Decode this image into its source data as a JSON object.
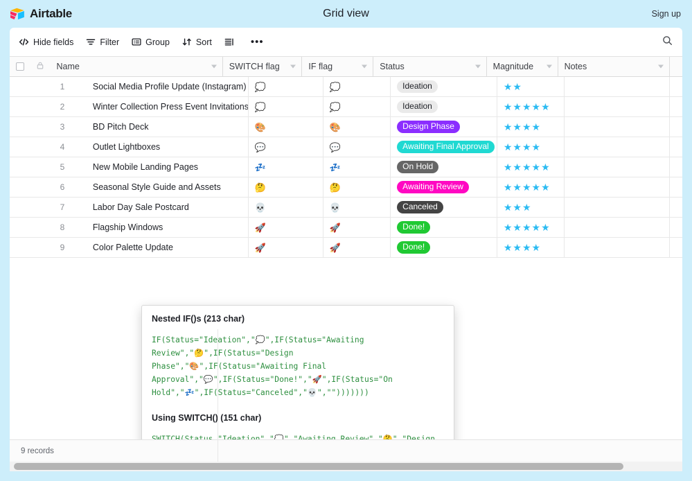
{
  "app": {
    "brand_name": "Airtable",
    "view_title": "Grid view",
    "signup_label": "Sign up",
    "accent_blue": "#cdeefb",
    "star_color": "#2bbbf2"
  },
  "toolbar": {
    "buttons": [
      {
        "label": "Hide fields",
        "icon": "code-brackets-icon"
      },
      {
        "label": "Filter",
        "icon": "filter-icon"
      },
      {
        "label": "Group",
        "icon": "group-icon"
      },
      {
        "label": "Sort",
        "icon": "sort-icon"
      },
      {
        "label": "",
        "icon": "row-height-icon"
      },
      {
        "label": "",
        "icon": "more-options-icon"
      }
    ],
    "search_icon": "search-icon"
  },
  "table": {
    "columns": [
      {
        "key": "name",
        "label": "Name"
      },
      {
        "key": "switch_flag",
        "label": "SWITCH flag"
      },
      {
        "key": "if_flag",
        "label": "IF flag"
      },
      {
        "key": "status",
        "label": "Status"
      },
      {
        "key": "magnitude",
        "label": "Magnitude"
      },
      {
        "key": "notes",
        "label": "Notes"
      }
    ],
    "rows": [
      {
        "num": "1",
        "name": "Social Media Profile Update (Instagram)",
        "switch_flag": "💭",
        "if_flag": "💭",
        "status": "Ideation",
        "status_bg": "#eaeaea",
        "status_fg": "#1d1f25",
        "magnitude": 2,
        "notes": ""
      },
      {
        "num": "2",
        "name": "Winter Collection Press Event Invitations",
        "switch_flag": "💭",
        "if_flag": "💭",
        "status": "Ideation",
        "status_bg": "#eaeaea",
        "status_fg": "#1d1f25",
        "magnitude": 5,
        "notes": ""
      },
      {
        "num": "3",
        "name": "BD Pitch Deck",
        "switch_flag": "🎨",
        "if_flag": "🎨",
        "status": "Design Phase",
        "status_bg": "#8b2eff",
        "status_fg": "#ffffff",
        "magnitude": 4,
        "notes": ""
      },
      {
        "num": "4",
        "name": "Outlet Lightboxes",
        "switch_flag": "💬",
        "if_flag": "💬",
        "status": "Awaiting Final Approval",
        "status_bg": "#20d9d2",
        "status_fg": "#ffffff",
        "magnitude": 4,
        "notes": ""
      },
      {
        "num": "5",
        "name": "New Mobile Landing Pages",
        "switch_flag": "💤",
        "if_flag": "💤",
        "status": "On Hold",
        "status_bg": "#666666",
        "status_fg": "#ffffff",
        "magnitude": 5,
        "notes": ""
      },
      {
        "num": "6",
        "name": "Seasonal Style Guide and Assets",
        "switch_flag": "🤔",
        "if_flag": "🤔",
        "status": "Awaiting Review",
        "status_bg": "#ff08c2",
        "status_fg": "#ffffff",
        "magnitude": 5,
        "notes": ""
      },
      {
        "num": "7",
        "name": "Labor Day Sale Postcard",
        "switch_flag": "💀",
        "if_flag": "💀",
        "status": "Canceled",
        "status_bg": "#444444",
        "status_fg": "#ffffff",
        "magnitude": 3,
        "notes": ""
      },
      {
        "num": "8",
        "name": "Flagship Windows",
        "switch_flag": "🚀",
        "if_flag": "🚀",
        "status": "Done!",
        "status_bg": "#20c933",
        "status_fg": "#ffffff",
        "magnitude": 5,
        "notes": ""
      },
      {
        "num": "9",
        "name": "Color Palette Update",
        "switch_flag": "🚀",
        "if_flag": "🚀",
        "status": "Done!",
        "status_bg": "#20c933",
        "status_fg": "#ffffff",
        "magnitude": 4,
        "notes": ""
      }
    ]
  },
  "popup": {
    "nested_heading": "Nested IF()s (213 char)",
    "nested_formula": "IF(Status=\"Ideation\",\"💭\",IF(Status=\"Awaiting Review\",\"🤔\",IF(Status=\"Design Phase\",\"🎨\",IF(Status=\"Awaiting Final Approval\",\"💬\",IF(Status=\"Done!\",\"🚀\",IF(Status=\"On Hold\",\"💤\",IF(Status=\"Canceled\",\"💀\",\"\")))))))",
    "switch_heading": "Using SWITCH() (151 char)",
    "switch_formula": "SWITCH(Status,\"Ideation\",\"💭\",\"Awaiting Review\",\"🤔\",\"Design Phase\",\"🎨\",\"Awaiting Final Approval\",\"💬\",\"Done!\",\"🚀\",\"On Hold\",\"💤\",\"Canceled\",\"💀\",\"\")"
  },
  "footer": {
    "record_count": "9 records"
  }
}
